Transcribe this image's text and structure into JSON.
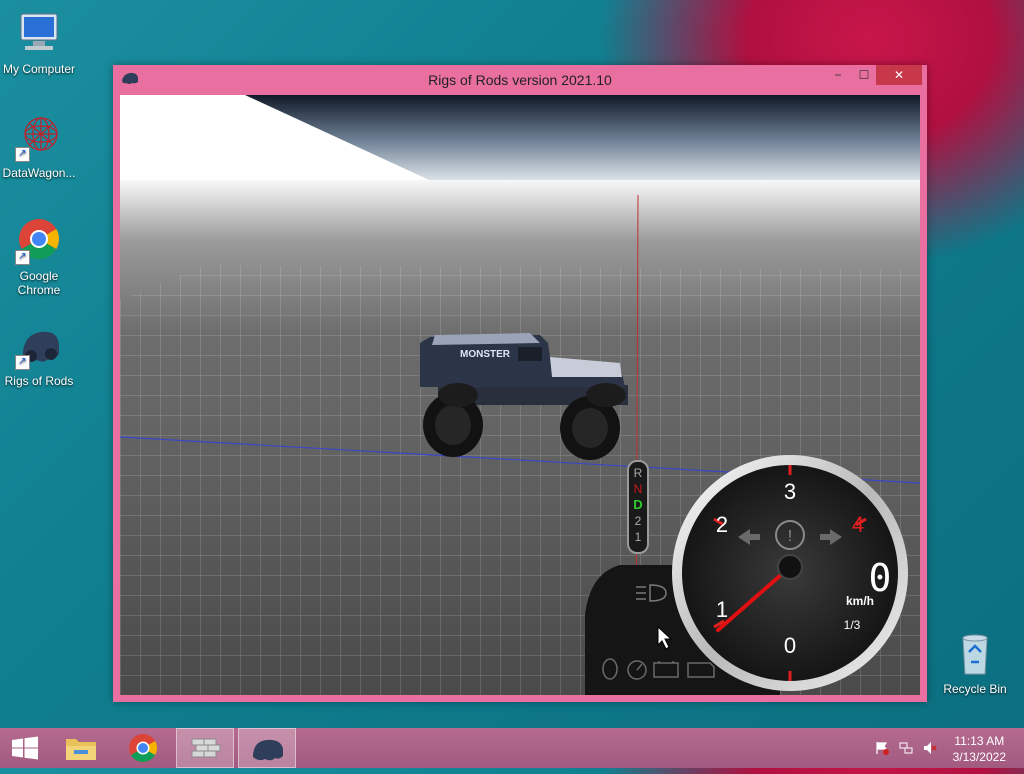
{
  "desktop": {
    "icons": [
      {
        "label": "My Computer",
        "icon": "computer-icon"
      },
      {
        "label": "DataWagon...",
        "icon": "datawagon-icon"
      },
      {
        "label": "Google\nChrome",
        "icon": "chrome-icon"
      },
      {
        "label": "Rigs of Rods",
        "icon": "rigs-of-rods-icon"
      },
      {
        "label": "Recycle Bin",
        "icon": "recycle-bin-icon"
      }
    ]
  },
  "window": {
    "title": "Rigs of Rods version 2021.10",
    "minimize": "−",
    "maximize": "☐",
    "close": "✕"
  },
  "game": {
    "gear_letters": [
      "R",
      "N",
      "D",
      "2",
      "1"
    ],
    "active_gear": "D",
    "speedometer": {
      "ticks": [
        "0",
        "1",
        "2",
        "3",
        "4"
      ],
      "digital_speed": "0",
      "unit": "km/h",
      "gear_ratio": "1/3"
    }
  },
  "taskbar": {
    "time": "11:13 AM",
    "date": "3/13/2022"
  },
  "colors": {
    "window_frame": "#e86fa0",
    "close_button": "#c7384a",
    "gauge_needle": "#e01010",
    "gear_active": "#2ecc2e",
    "gear_reverse_neutral": "#d01818"
  }
}
